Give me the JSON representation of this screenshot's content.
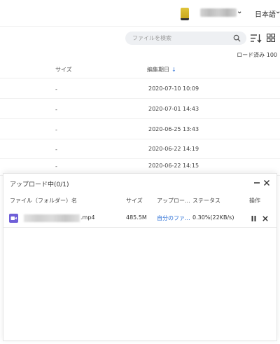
{
  "header": {
    "language": "日本語"
  },
  "toolbar": {
    "search_placeholder": "ファイルを検索",
    "loaded_count": "ロード済み 100"
  },
  "file_table": {
    "columns": {
      "size": "サイズ",
      "modified": "編集期日"
    },
    "rows": [
      {
        "size": "-",
        "modified": "2020-07-10 10:09"
      },
      {
        "size": "-",
        "modified": "2020-07-01 14:43"
      },
      {
        "size": "-",
        "modified": "2020-06-25 13:43"
      },
      {
        "size": "-",
        "modified": "2020-06-22 14:19"
      },
      {
        "size": "-",
        "modified": "2020-06-22 14:15"
      }
    ]
  },
  "upload_panel": {
    "title": "アップロード中(0/1)",
    "columns": {
      "name": "ファイル（フォルダー）名",
      "size": "サイズ",
      "destination": "アップロー...",
      "status": "ステータス",
      "action": "操作"
    },
    "items": [
      {
        "file_ext": "mp4",
        "size": "485.5M",
        "destination": "自分のファ...",
        "status": "0.30%(22KB/s)"
      }
    ]
  },
  "colors": {
    "accent": "#2b6fd6",
    "video_icon": "#6f5fd8"
  },
  "icons": {
    "search": "search-icon",
    "sort": "sort-icon",
    "grid": "grid-view-icon",
    "minimize": "minimize-icon",
    "close": "close-icon",
    "pause": "pause-icon",
    "cancel": "cancel-icon"
  }
}
